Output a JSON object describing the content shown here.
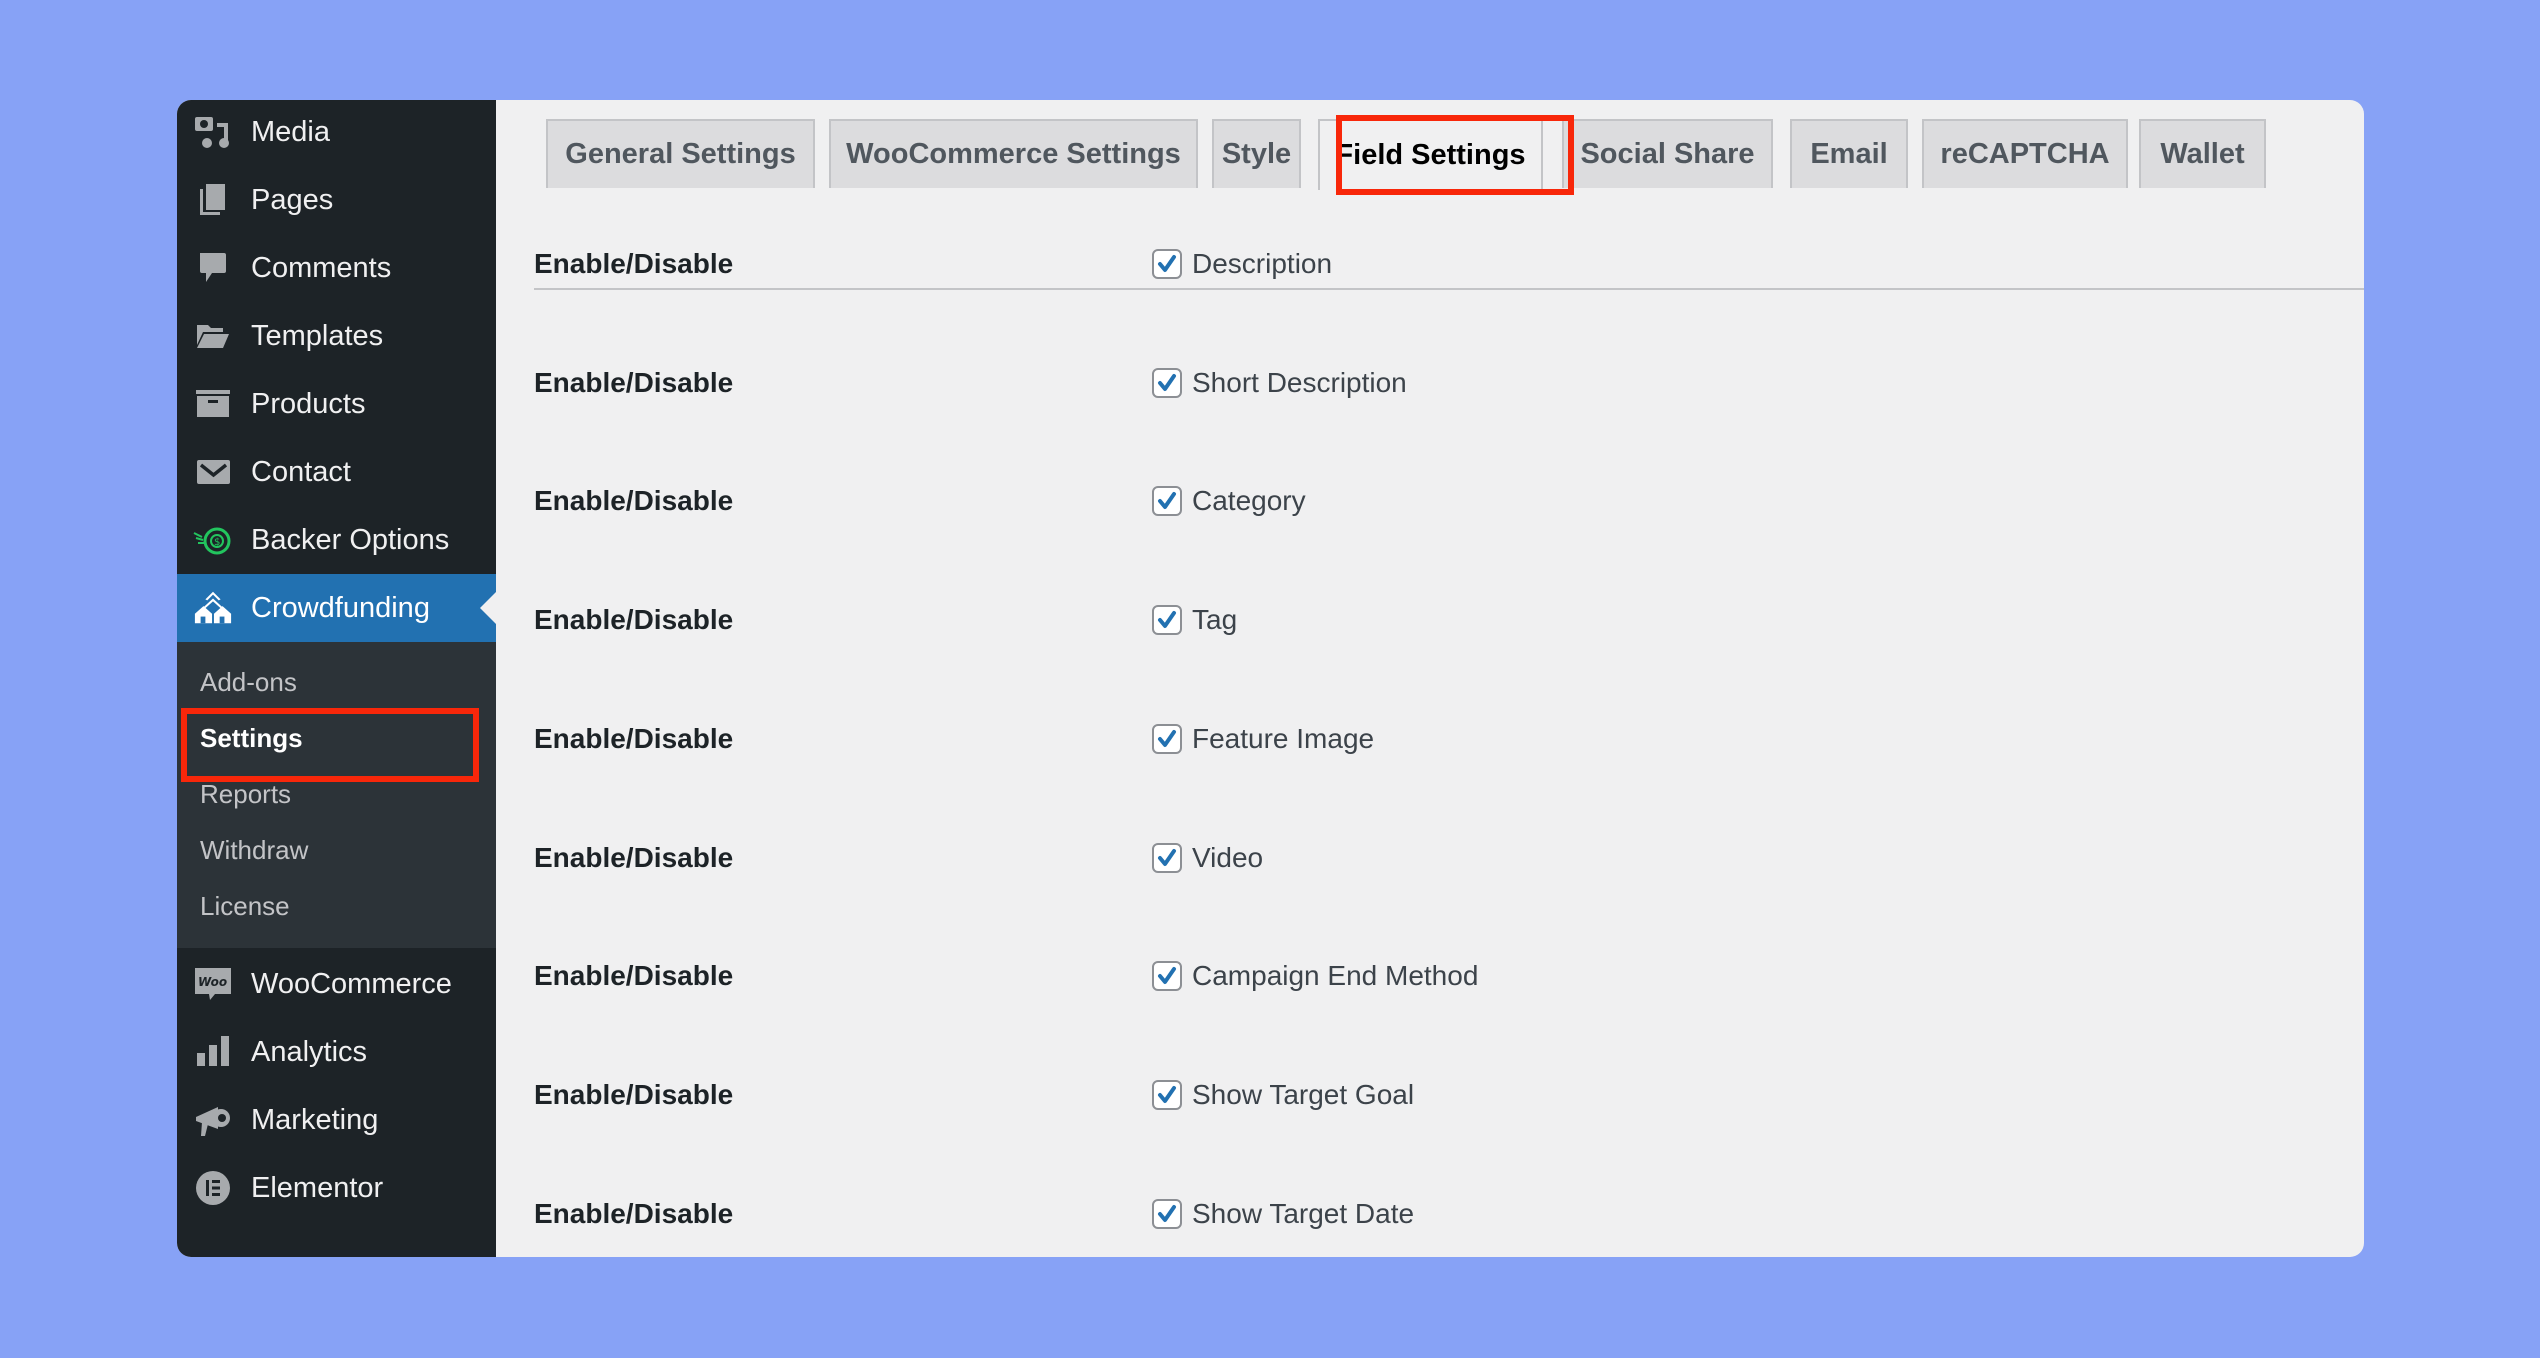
{
  "sidebar": {
    "items": [
      {
        "label": "Media",
        "icon": "media-icon"
      },
      {
        "label": "Pages",
        "icon": "pages-icon"
      },
      {
        "label": "Comments",
        "icon": "comments-icon"
      },
      {
        "label": "Templates",
        "icon": "folder-icon"
      },
      {
        "label": "Products",
        "icon": "archive-icon"
      },
      {
        "label": "Contact",
        "icon": "envelope-icon"
      },
      {
        "label": "Backer Options",
        "icon": "money-icon"
      },
      {
        "label": "Crowdfunding",
        "icon": "houses-icon",
        "active": true
      }
    ],
    "submenu": [
      {
        "label": "Add-ons"
      },
      {
        "label": "Settings",
        "current": true
      },
      {
        "label": "Reports"
      },
      {
        "label": "Withdraw"
      },
      {
        "label": "License"
      }
    ],
    "items_after": [
      {
        "label": "WooCommerce",
        "icon": "woo-icon"
      },
      {
        "label": "Analytics",
        "icon": "bar-chart-icon"
      },
      {
        "label": "Marketing",
        "icon": "megaphone-icon"
      },
      {
        "label": "Elementor",
        "icon": "elementor-icon"
      }
    ]
  },
  "tabs": [
    {
      "label": "General Settings"
    },
    {
      "label": "WooCommerce Settings"
    },
    {
      "label": "Style"
    },
    {
      "label": "Field Settings",
      "active": true
    },
    {
      "label": "Social Share"
    },
    {
      "label": "Email"
    },
    {
      "label": "reCAPTCHA"
    },
    {
      "label": "Wallet"
    }
  ],
  "fields": [
    {
      "label": "Enable/Disable",
      "option": "Description",
      "checked": true
    },
    {
      "label": "Enable/Disable",
      "option": "Short Description",
      "checked": true
    },
    {
      "label": "Enable/Disable",
      "option": "Category",
      "checked": true
    },
    {
      "label": "Enable/Disable",
      "option": "Tag",
      "checked": true
    },
    {
      "label": "Enable/Disable",
      "option": "Feature Image",
      "checked": true
    },
    {
      "label": "Enable/Disable",
      "option": "Video",
      "checked": true
    },
    {
      "label": "Enable/Disable",
      "option": "Campaign End Method",
      "checked": true
    },
    {
      "label": "Enable/Disable",
      "option": "Show Target Goal",
      "checked": true
    },
    {
      "label": "Enable/Disable",
      "option": "Show Target Date",
      "checked": true
    }
  ],
  "colors": {
    "background": "#87a2f6",
    "sidebar": "#1d2327",
    "submenu": "#2c3338",
    "active_menu": "#2271b1",
    "highlight": "#f8270a",
    "checkmark": "#2271b1"
  }
}
